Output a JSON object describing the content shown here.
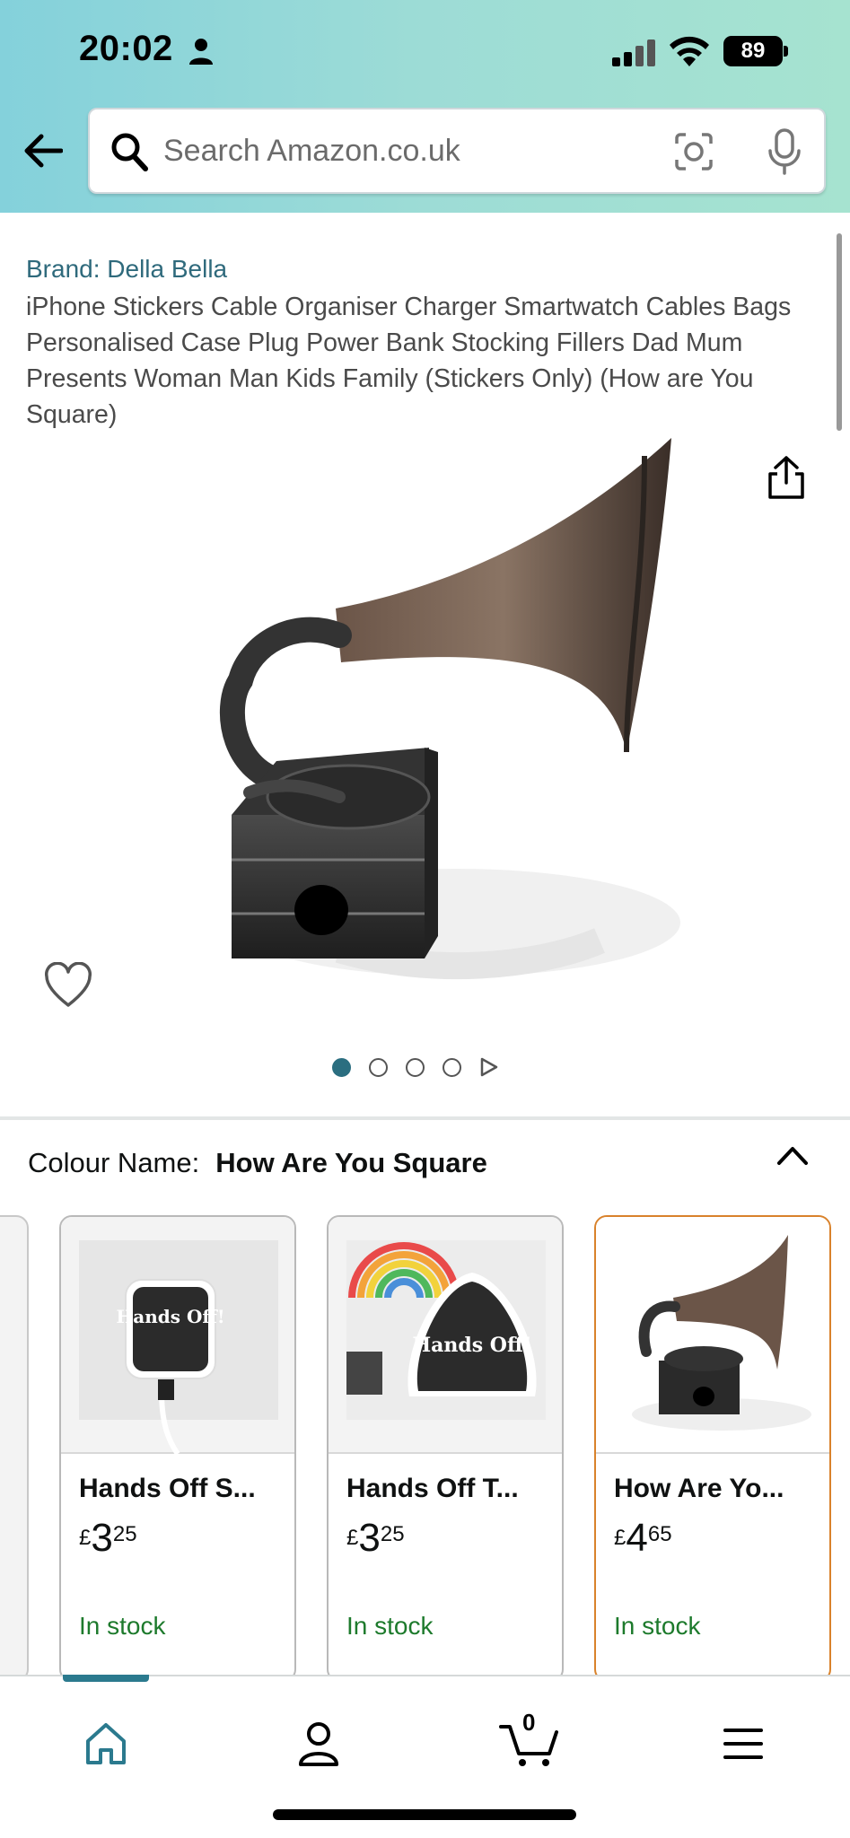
{
  "status_bar": {
    "time": "20:02",
    "battery": "89"
  },
  "search": {
    "placeholder": "Search Amazon.co.uk"
  },
  "product": {
    "brand": "Brand: Della Bella",
    "title": "iPhone Stickers Cable Organiser Charger Smartwatch Cables Bags Personalised Case Plug Power Bank Stocking Fillers Dad Mum Presents Woman Man Kids Family (Stickers Only) (How are You Square)",
    "image_index": 1,
    "image_count": 4
  },
  "variation": {
    "label": "Colour Name:",
    "selected": "How Are You Square",
    "options": [
      {
        "name": "Hands Off S...",
        "currency": "£",
        "whole": "3",
        "fraction": "25",
        "stock": "In stock",
        "image_text": "Hands Off!"
      },
      {
        "name": "Hands Off T...",
        "currency": "£",
        "whole": "3",
        "fraction": "25",
        "stock": "In stock",
        "image_text": "Hands Off!"
      },
      {
        "name": "How Are Yo...",
        "currency": "£",
        "whole": "4",
        "fraction": "65",
        "stock": "In stock",
        "selected": true
      }
    ]
  },
  "cart": {
    "count": "0"
  },
  "colors": {
    "accent": "#2b6e80",
    "selected_border": "#d9822b",
    "in_stock": "#1d7a2c",
    "brand_link": "#2f6a7c"
  }
}
